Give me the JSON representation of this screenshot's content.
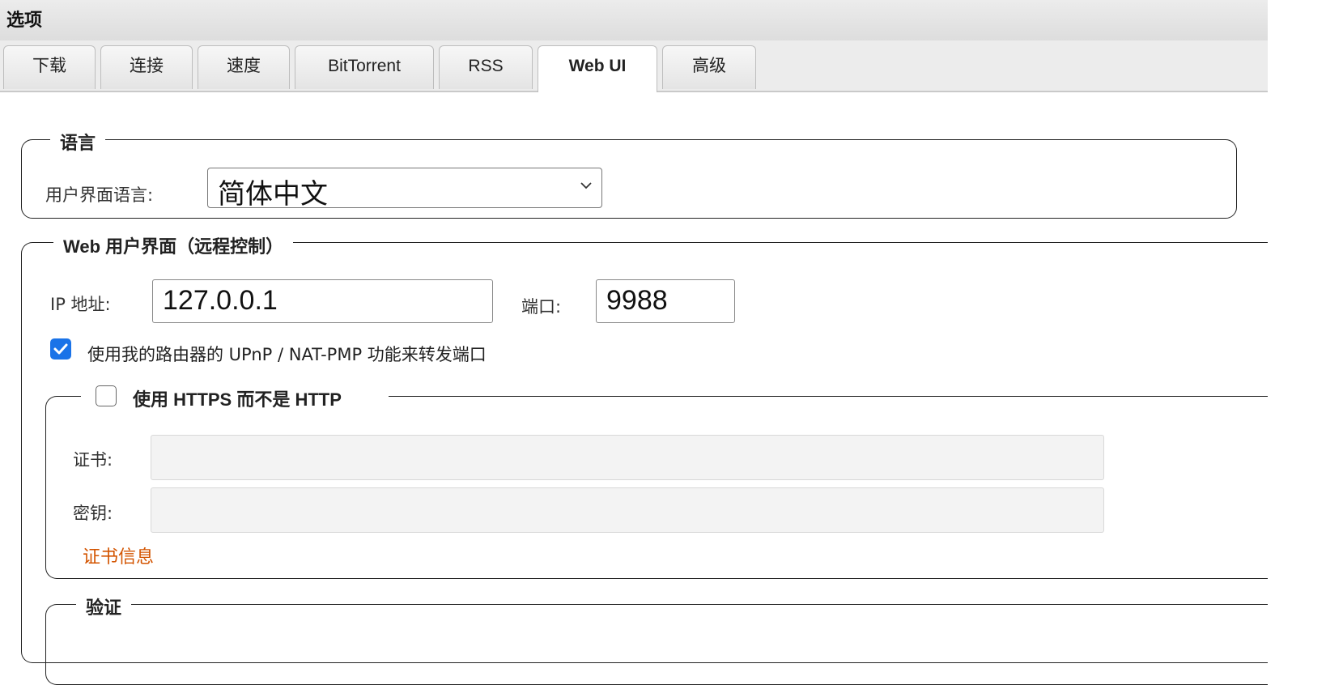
{
  "dialog": {
    "title": "选项",
    "close_icon": "close-icon"
  },
  "tabs": [
    {
      "label": "下载",
      "active": false
    },
    {
      "label": "连接",
      "active": false
    },
    {
      "label": "速度",
      "active": false
    },
    {
      "label": "BitTorrent",
      "active": false
    },
    {
      "label": "RSS",
      "active": false
    },
    {
      "label": "Web UI",
      "active": true
    },
    {
      "label": "高级",
      "active": false
    }
  ],
  "language_section": {
    "legend": "语言",
    "ui_language_label": "用户界面语言:",
    "ui_language_value": "简体中文"
  },
  "webui_section": {
    "legend": "Web 用户界面（远程控制）",
    "ip_label": "IP 地址:",
    "ip_value": "127.0.0.1",
    "port_label": "端口:",
    "port_value": "9988",
    "upnp_label": "使用我的路由器的 UPnP / NAT-PMP 功能来转发端口",
    "upnp_checked": true
  },
  "https_section": {
    "legend": "使用 HTTPS 而不是 HTTP",
    "https_checked": false,
    "cert_label": "证书:",
    "cert_value": "",
    "key_label": "密钥:",
    "key_value": "",
    "cert_info_link": "证书信息"
  },
  "auth_section": {
    "legend": "验证"
  },
  "colors": {
    "accent": "#1a73e8",
    "link": "#d35400"
  }
}
